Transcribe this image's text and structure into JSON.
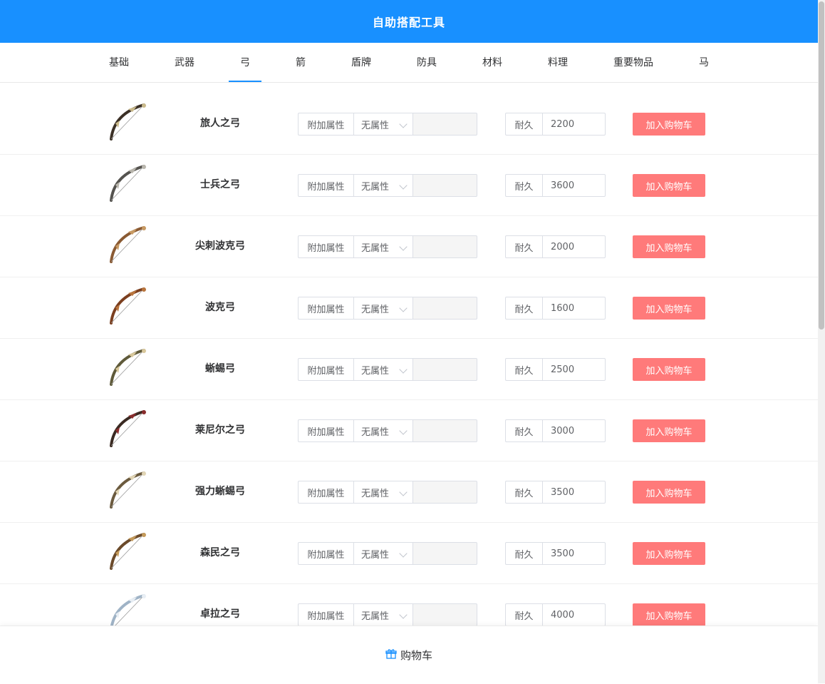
{
  "header": {
    "title": "自助搭配工具"
  },
  "tabs": [
    {
      "label": "基础"
    },
    {
      "label": "武器"
    },
    {
      "label": "弓",
      "active": true
    },
    {
      "label": "箭"
    },
    {
      "label": "盾牌"
    },
    {
      "label": "防具"
    },
    {
      "label": "材料"
    },
    {
      "label": "料理"
    },
    {
      "label": "重要物品"
    },
    {
      "label": "马"
    }
  ],
  "row_common": {
    "attr_label": "附加属性",
    "attr_select_value": "无属性",
    "durability_label": "耐久",
    "add_button": "加入购物车"
  },
  "items": [
    {
      "name": "旅人之弓",
      "durability": "2200",
      "icon": "bow-icon",
      "bow_color": "#3b3026",
      "accent": "#c9b98a"
    },
    {
      "name": "士兵之弓",
      "durability": "3600",
      "icon": "bow-icon",
      "bow_color": "#55534f",
      "accent": "#b9b6ad"
    },
    {
      "name": "尖刺波克弓",
      "durability": "2000",
      "icon": "bow-icon",
      "bow_color": "#8a5a33",
      "accent": "#c79a63"
    },
    {
      "name": "波克弓",
      "durability": "1600",
      "icon": "bow-icon",
      "bow_color": "#7b3f1f",
      "accent": "#b9753d"
    },
    {
      "name": "蜥蜴弓",
      "durability": "2500",
      "icon": "bow-icon",
      "bow_color": "#5f5a3a",
      "accent": "#d8c79b"
    },
    {
      "name": "莱尼尔之弓",
      "durability": "3000",
      "icon": "bow-icon",
      "bow_color": "#3a2a22",
      "accent": "#8a2d2d"
    },
    {
      "name": "强力蜥蜴弓",
      "durability": "3500",
      "icon": "bow-icon",
      "bow_color": "#6b5a3e",
      "accent": "#e1d5b5"
    },
    {
      "name": "森民之弓",
      "durability": "3500",
      "icon": "bow-icon",
      "bow_color": "#6b4a2a",
      "accent": "#c49a5a"
    },
    {
      "name": "卓拉之弓",
      "durability": "4000",
      "icon": "bow-icon",
      "bow_color": "#9fb3c6",
      "accent": "#e8eef4"
    }
  ],
  "footer": {
    "cart_label": "购物车",
    "cart_icon": "gift-icon"
  },
  "colors": {
    "header": "#1890ff",
    "add_button": "#ff7a7a",
    "active_tab_underline": "#1890ff"
  }
}
